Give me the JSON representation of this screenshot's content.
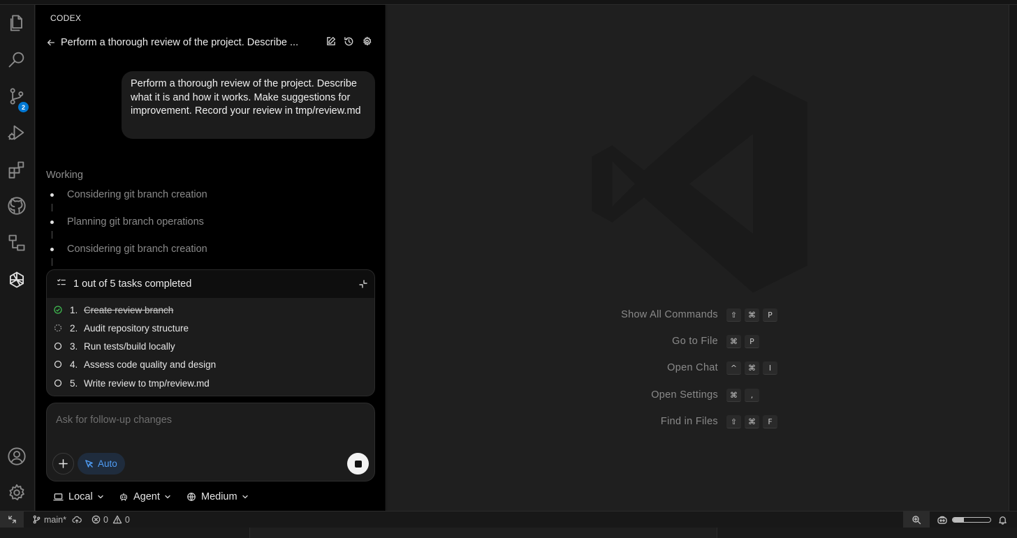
{
  "activity_bar": {
    "items": [
      {
        "icon": "files-icon"
      },
      {
        "icon": "search-icon"
      },
      {
        "icon": "source-control-icon",
        "badge": "2"
      },
      {
        "icon": "run-debug-icon"
      },
      {
        "icon": "extensions-icon"
      },
      {
        "icon": "github-icon"
      },
      {
        "icon": "remote-explorer-icon"
      },
      {
        "icon": "codex-icon"
      }
    ],
    "bottom": [
      {
        "icon": "account-icon"
      },
      {
        "icon": "gear-icon"
      }
    ]
  },
  "panel": {
    "title": "CODEX",
    "thread_title": "Perform a thorough review of the project. Describe ...",
    "user_message": "Perform a thorough review of the project. Describe what it is and how it works. Make suggestions for improvement. Record your review in tmp/review.md",
    "status": "Working",
    "steps": [
      "Considering git branch creation",
      "Planning git branch operations",
      "Considering git branch creation"
    ],
    "tasks": {
      "title": "1 out of 5 tasks completed",
      "items": [
        {
          "num": "1.",
          "label": "Create review branch",
          "state": "done"
        },
        {
          "num": "2.",
          "label": "Audit repository structure",
          "state": "in-progress"
        },
        {
          "num": "3.",
          "label": "Run tests/build locally",
          "state": "pending"
        },
        {
          "num": "4.",
          "label": "Assess code quality and design",
          "state": "pending"
        },
        {
          "num": "5.",
          "label": "Write review to tmp/review.md",
          "state": "pending"
        }
      ]
    },
    "composer": {
      "placeholder": "Ask for follow-up changes",
      "mode_label": "Auto"
    },
    "selectors": {
      "environment": "Local",
      "agent": "Agent",
      "reasoning": "Medium"
    }
  },
  "editor": {
    "shortcuts": [
      {
        "label": "Show All Commands",
        "keys": [
          "⇧",
          "⌘",
          "P"
        ]
      },
      {
        "label": "Go to File",
        "keys": [
          "⌘",
          "P"
        ]
      },
      {
        "label": "Open Chat",
        "keys": [
          "^",
          "⌘",
          "I"
        ]
      },
      {
        "label": "Open Settings",
        "keys": [
          "⌘",
          ","
        ]
      },
      {
        "label": "Find in Files",
        "keys": [
          "⇧",
          "⌘",
          "F"
        ]
      }
    ]
  },
  "status_bar": {
    "branch": "main*",
    "errors": "0",
    "warnings": "0",
    "zoom_level": 0.3
  }
}
